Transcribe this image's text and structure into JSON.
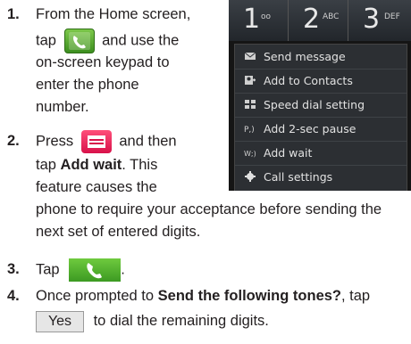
{
  "steps": [
    {
      "number": "1.",
      "line1_before": "From the Home screen,",
      "line2_before": "tap",
      "line2_after": "and use the",
      "line3": "on-screen keypad to",
      "line4": "enter the phone",
      "line5": "number."
    },
    {
      "number": "2.",
      "line1_before": "Press",
      "line1_after": "and then",
      "line2_before": "tap",
      "line2_bold": "Add wait",
      "line2_after": ". This",
      "line3": "feature causes the",
      "line4": "phone to require your acceptance before sending the",
      "line5": "next set of entered digits."
    },
    {
      "number": "3.",
      "line1_before": "Tap",
      "line1_after": "."
    },
    {
      "number": "4.",
      "line1_before": "Once prompted to",
      "line1_bold": "Send the following tones?",
      "line1_after": ", tap",
      "yes_label": "Yes",
      "line2_after": "to dial the remaining digits."
    }
  ],
  "phone_screen": {
    "keys": [
      {
        "digit": "1",
        "letters": "oo"
      },
      {
        "digit": "2",
        "letters": "ABC"
      },
      {
        "digit": "3",
        "letters": "DEF"
      }
    ],
    "menu_items": [
      {
        "label": "Send message",
        "icon": "message-icon"
      },
      {
        "label": "Add to Contacts",
        "icon": "contacts-icon"
      },
      {
        "label": "Speed dial setting",
        "icon": "speed-dial-icon"
      },
      {
        "label": "Add 2-sec pause",
        "icon": "pause-icon"
      },
      {
        "label": "Add wait",
        "icon": "wait-icon"
      },
      {
        "label": "Call settings",
        "icon": "gear-icon"
      }
    ]
  }
}
